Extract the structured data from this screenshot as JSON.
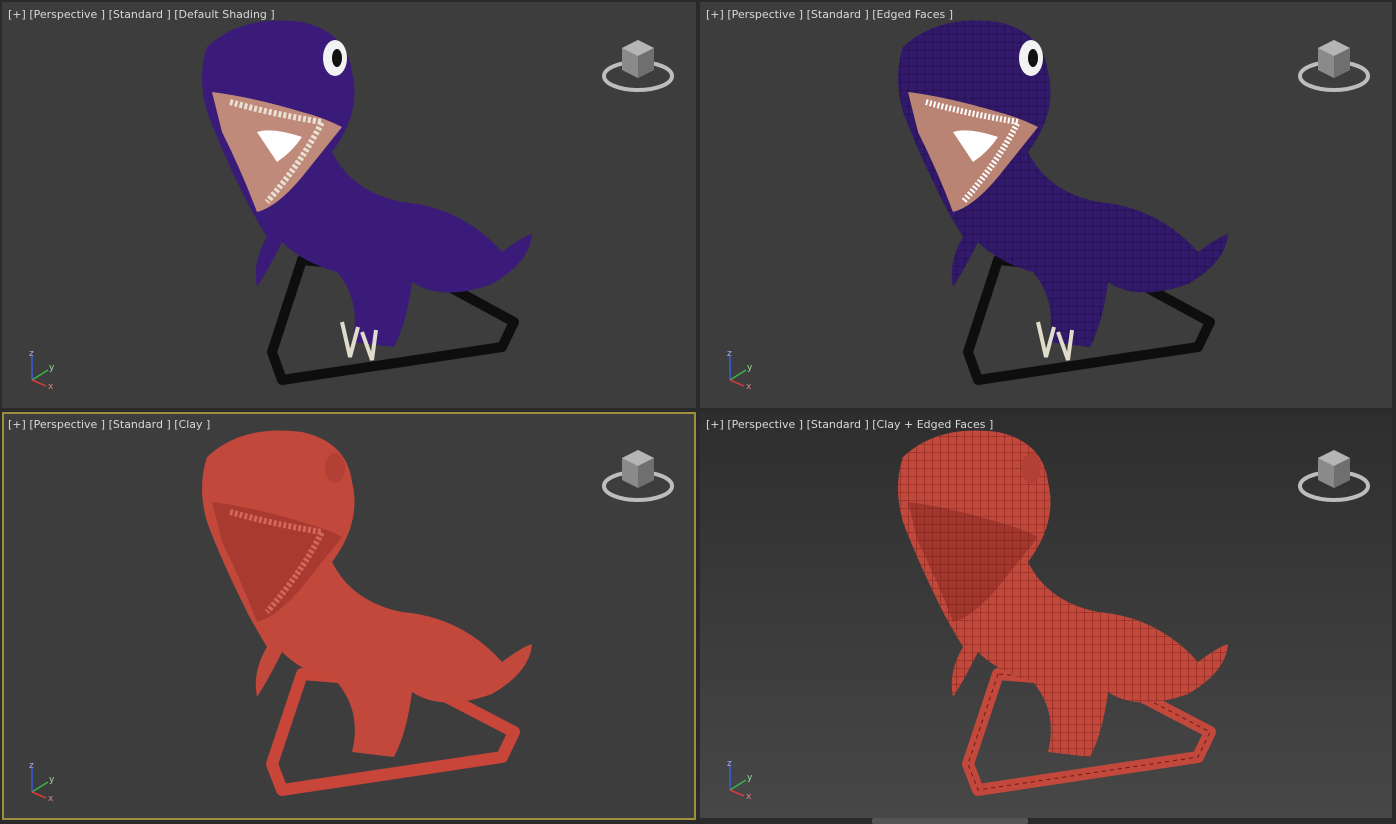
{
  "viewports": [
    {
      "id": "top-left",
      "label": {
        "plus": "[+]",
        "view": "[Perspective ]",
        "preset": "[Standard ]",
        "shading": "[Default Shading ]"
      },
      "active": false
    },
    {
      "id": "top-right",
      "label": {
        "plus": "[+]",
        "view": "[Perspective ]",
        "preset": "[Standard ]",
        "shading": "[Edged Faces ]"
      },
      "active": false
    },
    {
      "id": "bottom-left",
      "label": {
        "plus": "[+]",
        "view": "[Perspective ]",
        "preset": "[Standard ]",
        "shading": "[Clay ]"
      },
      "active": true
    },
    {
      "id": "bottom-right",
      "label": {
        "plus": "[+]",
        "view": "[Perspective ]",
        "preset": "[Standard ]",
        "shading": "[Clay + Edged Faces ]"
      },
      "active": false
    }
  ],
  "axis": {
    "z": "z",
    "y": "y",
    "x": "x"
  },
  "colors": {
    "active_border": "#a08f3a",
    "dino_purple": "#3b1b7a",
    "dino_clay": "#c2483c",
    "viewport_bg": "#3d3d3d"
  }
}
